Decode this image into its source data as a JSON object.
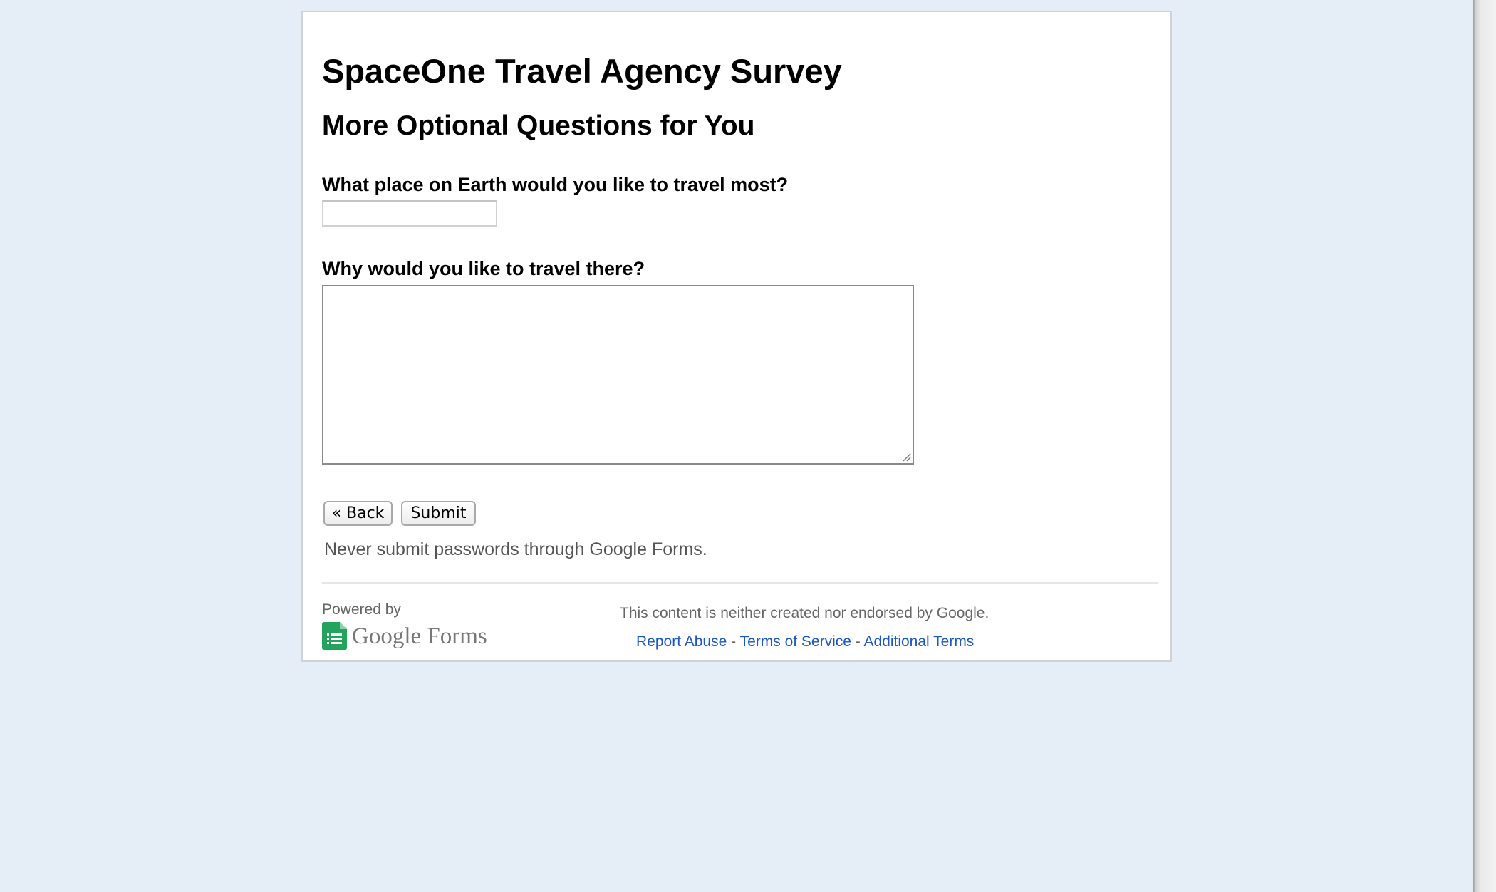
{
  "form": {
    "title": "SpaceOne Travel Agency Survey",
    "page_title": "More Optional Questions for You",
    "questions": [
      {
        "label": "What place on Earth would you like to travel most?",
        "value": ""
      },
      {
        "label": "Why would you like to travel there?",
        "value": ""
      }
    ],
    "buttons": {
      "back_label": "« Back",
      "submit_label": "Submit"
    },
    "password_notice": "Never submit passwords through Google Forms."
  },
  "footer": {
    "powered_by": "Powered by",
    "logo_text": "Google Forms",
    "logo_icon": "google-forms-icon",
    "disclaimer": "This content is neither created nor endorsed by Google.",
    "links": {
      "report_abuse": "Report Abuse",
      "terms_of_service": "Terms of Service",
      "additional_terms": "Additional Terms",
      "separator": " - "
    }
  },
  "colors": {
    "page_background": "#e5edf7",
    "link": "#1a56c4",
    "forms_green": "#22a45d"
  }
}
